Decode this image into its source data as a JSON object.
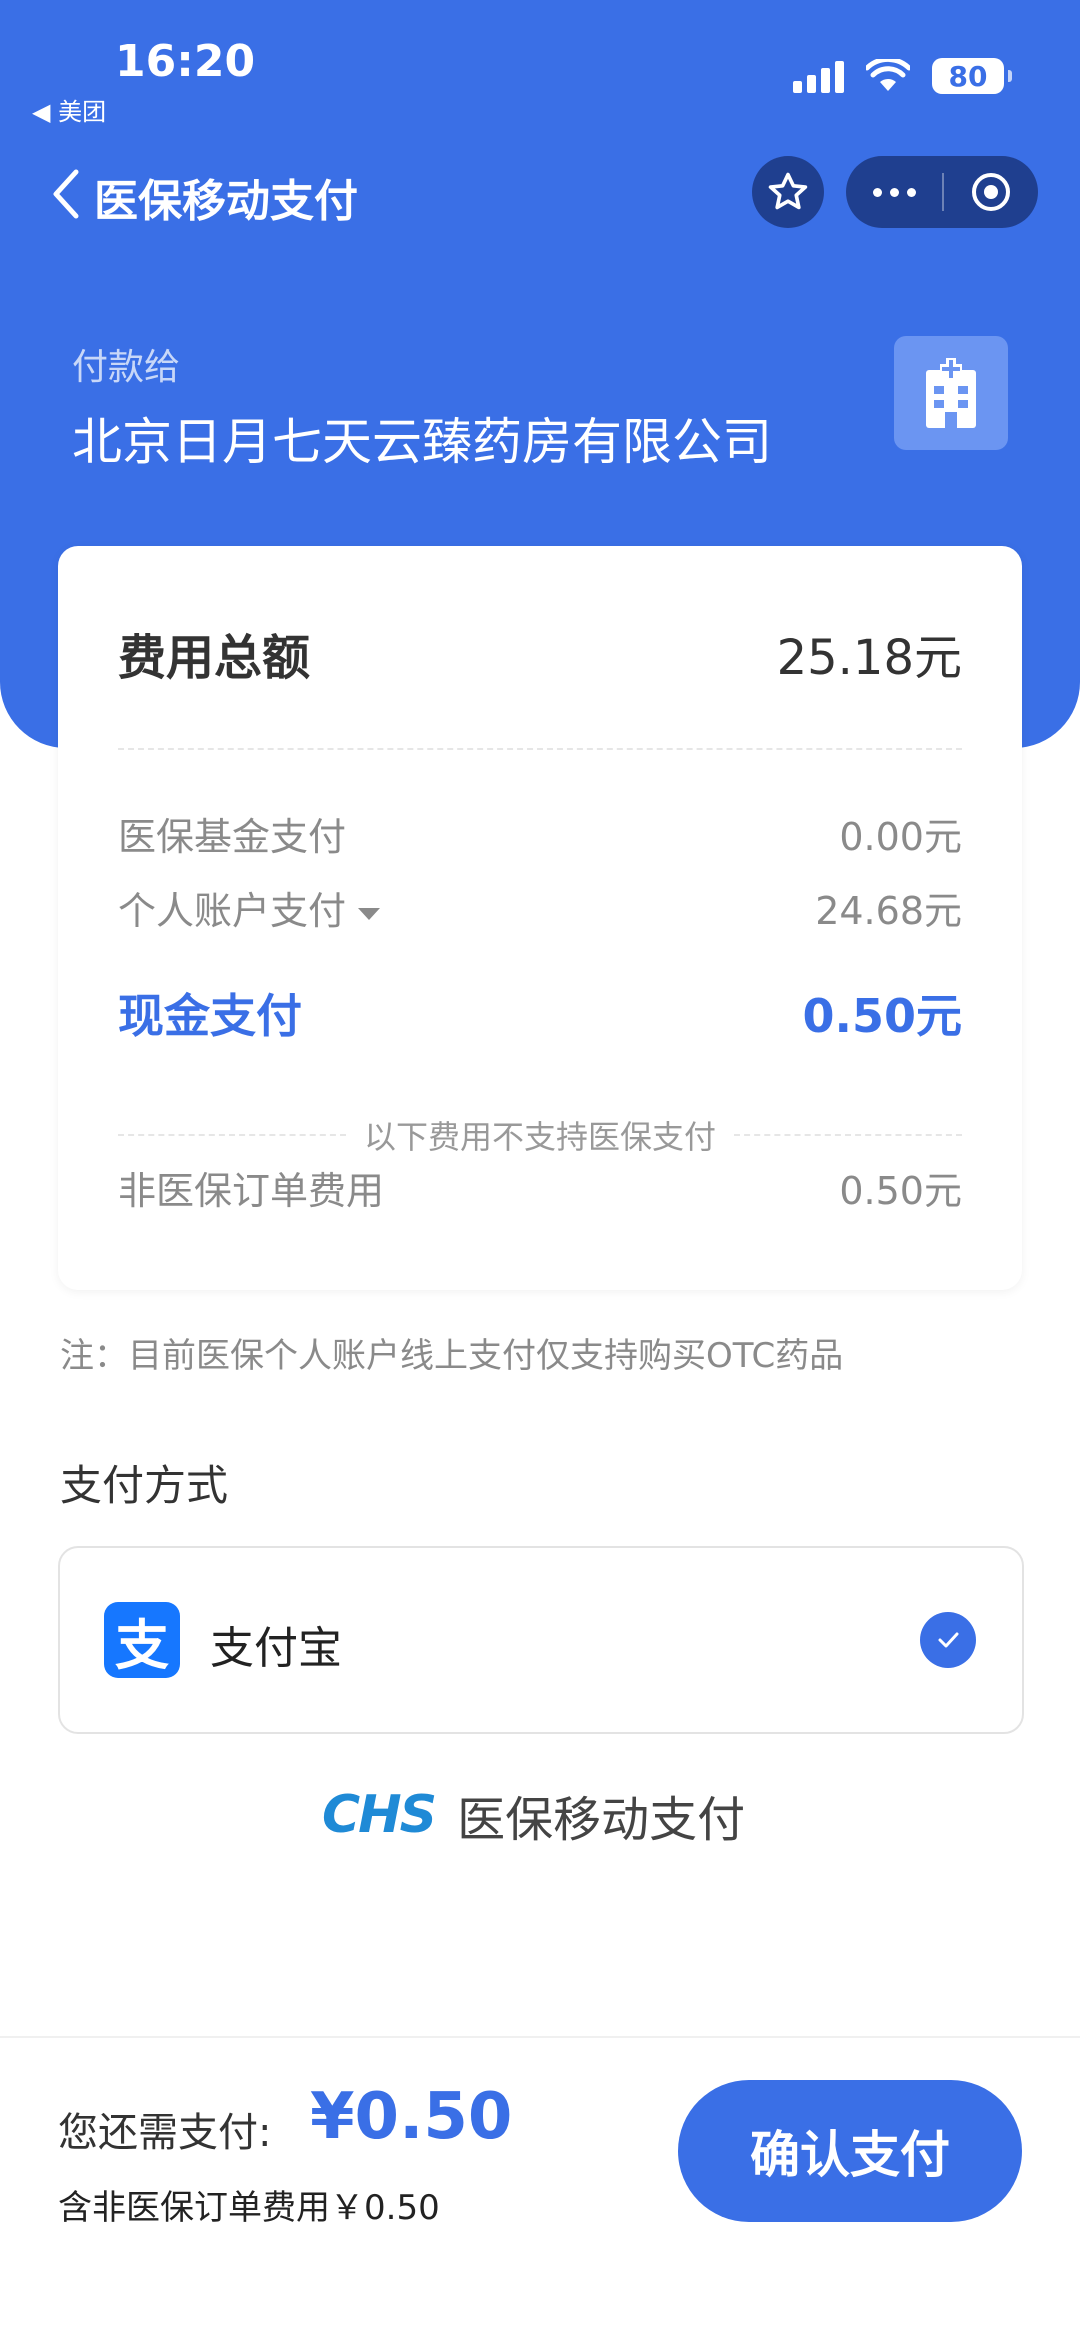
{
  "status_bar": {
    "time": "16:20",
    "back_app": "◀ 美团",
    "battery": "80"
  },
  "nav": {
    "title": "医保移动支付"
  },
  "payee": {
    "label": "付款给",
    "name": "北京日月七天云臻药房有限公司"
  },
  "summary": {
    "total_label": "费用总额",
    "total_value": "25.18元",
    "fund_label": "医保基金支付",
    "fund_value": "0.00元",
    "account_label": "个人账户支付",
    "account_value": "24.68元",
    "cash_label": "现金支付",
    "cash_value": "0.50元",
    "divider_text": "以下费用不支持医保支付",
    "non_insured_label": "非医保订单费用",
    "non_insured_value": "0.50元"
  },
  "note": "注：目前医保个人账户线上支付仅支持购买OTC药品",
  "payment": {
    "title": "支付方式",
    "method_icon_glyph": "支",
    "method_label": "支付宝"
  },
  "brand": {
    "logo": "CHS",
    "text": "医保移动支付"
  },
  "bottom": {
    "due_label": "您还需支付:",
    "due_amount": "¥0.50",
    "due_note": "含非医保订单费用￥0.50",
    "confirm_label": "确认支付"
  },
  "colors": {
    "primary": "#3a6fe6",
    "alipay": "#1677ff"
  }
}
